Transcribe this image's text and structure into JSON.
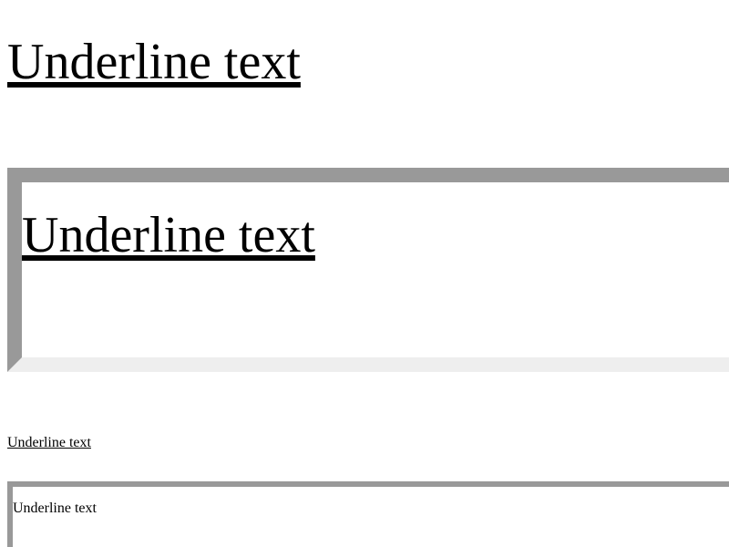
{
  "blocks": {
    "first_heading": "Underline text",
    "boxed_heading": "Underline text",
    "small_text": "Underline text",
    "boxed_small_text": "Underline text"
  },
  "colors": {
    "border_dark": "#999999",
    "border_light": "#eeeeee",
    "text": "#000000",
    "background": "#ffffff"
  }
}
